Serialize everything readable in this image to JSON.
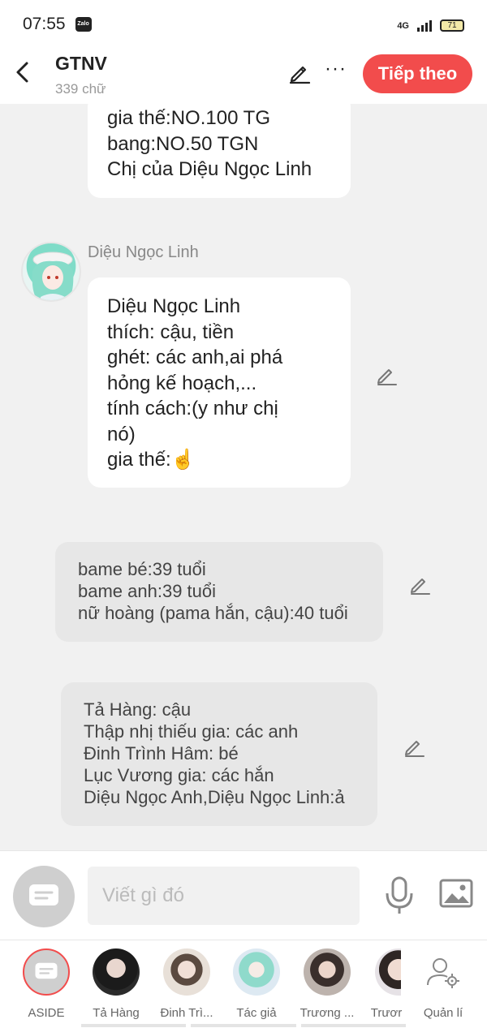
{
  "status_bar": {
    "time": "07:55",
    "app_badge": "Zalo",
    "network": "4G",
    "battery": "71"
  },
  "header": {
    "title": "GTNV",
    "word_count": "339 chữ",
    "next_label": "Tiếp theo",
    "more_label": "···"
  },
  "messages": [
    {
      "lines": [
        "gia thế:NO.100 TG",
        "bang:NO.50 TGN",
        "Chị của Diệu Ngọc Linh"
      ]
    },
    {
      "sender": "Diệu Ngọc Linh",
      "lines": [
        "Diệu Ngọc Linh",
        "thích: cậu, tiền",
        "ghét: các anh,ai phá",
        "hỏng kế hoạch,...",
        "tính cách:(y như chị",
        "nó)",
        "gia thế:☝️"
      ]
    },
    {
      "lines": [
        "bame bé:39 tuổi",
        "bame anh:39 tuổi",
        "nữ hoàng (pama hắn, cậu):40 tuổi"
      ]
    },
    {
      "lines": [
        "Tả Hàng: cậu",
        "Thập nhị thiếu gia: các anh",
        "Đinh Trình Hâm: bé",
        "Lục Vương gia: các hắn",
        "Diệu Ngọc Anh,Diệu Ngọc Linh:ả"
      ]
    }
  ],
  "input": {
    "placeholder": "Viết gì đó",
    "value": ""
  },
  "characters": [
    {
      "label": "ASIDE"
    },
    {
      "label": "Tả Hàng"
    },
    {
      "label": "Đinh Trì..."
    },
    {
      "label": "Tác giả"
    },
    {
      "label": "Trương ..."
    },
    {
      "label": "Trươr"
    },
    {
      "label": "Quản lí"
    }
  ],
  "colors": {
    "accent": "#f24c4c",
    "background": "#f1f1f1",
    "bubble_white": "#ffffff",
    "bubble_grey": "#e7e7e7"
  }
}
